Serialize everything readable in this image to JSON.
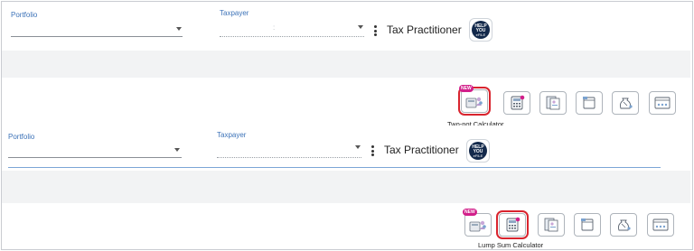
{
  "panels": [
    {
      "portfolio_label": "Portfolio",
      "taxpayer_label": "Taxpayer",
      "taxpayer_value_separator": ":",
      "practitioner_label": "Tax Practitioner",
      "help_badge_text": "HELP YOU eFILE",
      "tools": [
        {
          "name": "two-pot-calculator",
          "badge": "NEW",
          "icon": "calculator-people-icon"
        },
        {
          "name": "lump-sum-calculator",
          "icon": "calculator-icon"
        },
        {
          "name": "documents-tool",
          "icon": "documents-icon"
        },
        {
          "name": "notes-tool",
          "icon": "notes-icon"
        },
        {
          "name": "bag-tool",
          "icon": "money-bag-icon"
        },
        {
          "name": "browser-tool",
          "icon": "browser-icon"
        }
      ],
      "selected_tool": "Two-pot Calculator",
      "caption": "Two-pot Calculator"
    },
    {
      "portfolio_label": "Portfolio",
      "taxpayer_label": "Taxpayer",
      "practitioner_label": "Tax Practitioner",
      "help_badge_text": "HELP YOU eFILE",
      "tools": [
        {
          "name": "two-pot-calculator",
          "badge": "NEW",
          "icon": "calculator-people-icon"
        },
        {
          "name": "lump-sum-calculator",
          "icon": "calculator-icon"
        },
        {
          "name": "documents-tool",
          "icon": "documents-icon"
        },
        {
          "name": "notes-tool",
          "icon": "notes-icon"
        },
        {
          "name": "bag-tool",
          "icon": "money-bag-icon"
        },
        {
          "name": "browser-tool",
          "icon": "browser-icon"
        }
      ],
      "selected_tool": "Lump Sum Calculator",
      "caption": "Lump Sum Calculator"
    }
  ],
  "colors": {
    "accent_blue": "#3d73b8",
    "highlight_red": "#d9242e",
    "new_badge": "#d21f8a",
    "band_gray": "#f2f3f4",
    "help_badge_dark": "#13294b"
  }
}
